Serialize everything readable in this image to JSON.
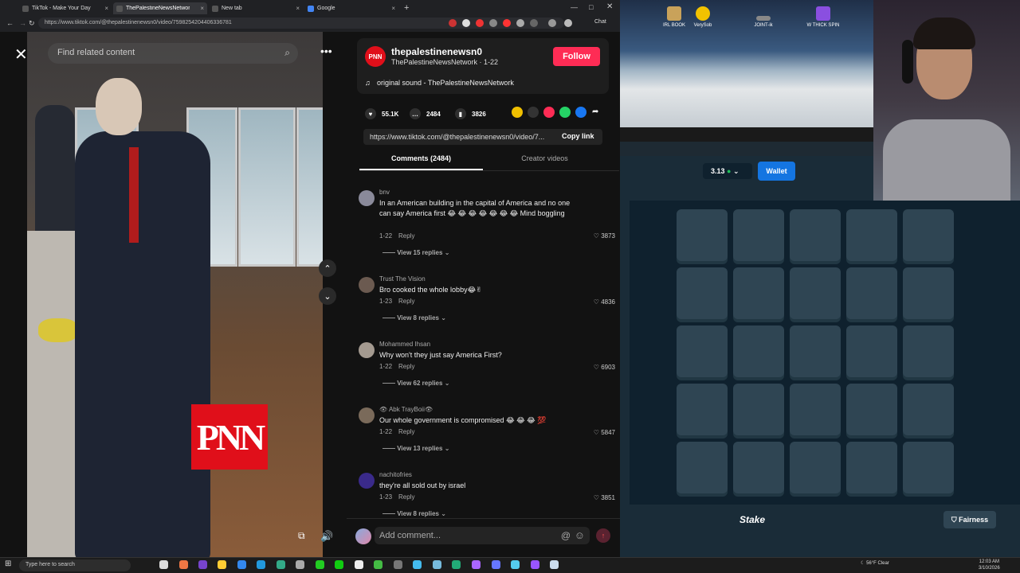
{
  "browser": {
    "tabs": [
      {
        "label": "TikTok - Make Your Day",
        "active": false
      },
      {
        "label": "ThePalestineNewsNetwork (@",
        "active": true
      },
      {
        "label": "New tab",
        "active": false
      },
      {
        "label": "Google",
        "active": false
      }
    ],
    "url": "https://www.tiktok.com/@thepalestinenewsn0/video/7598254204406336781",
    "new_tab_symbol": "+",
    "chat_label": "Chat"
  },
  "video": {
    "search_placeholder": "Find related content",
    "logo_text": "PNN"
  },
  "author": {
    "avatar_text": "PNN",
    "username": "thepalestinenewsn0",
    "display": "ThePalestineNewsNetwork · 1-22",
    "follow_label": "Follow",
    "sound": "original sound - ThePalestineNewsNetwork"
  },
  "stats": {
    "likes": "55.1K",
    "comments": "2484",
    "saves": "3826"
  },
  "link": {
    "url": "https://www.tiktok.com/@thepalestinenewsn0/video/7...",
    "copy_label": "Copy link"
  },
  "tabs": {
    "comments": "Comments (2484)",
    "creator": "Creator videos"
  },
  "comments": [
    {
      "user": "bnv",
      "text": "In an American building in the capital of America and no one can say America first 😂 😂 😂 😂 😂 😂 😂 Mind boggling",
      "date": "1-22",
      "reply": "Reply",
      "likes": "3873",
      "replies": "View 15 replies"
    },
    {
      "user": "Trust The Vision",
      "text": "Bro cooked the whole lobby😂✌",
      "date": "1-23",
      "reply": "Reply",
      "likes": "4836",
      "replies": "View 8 replies"
    },
    {
      "user": "Mohammed Ihsan",
      "text": "Why won't they just say America First?",
      "date": "1-22",
      "reply": "Reply",
      "likes": "6903",
      "replies": "View 62 replies"
    },
    {
      "user": "👁 Abk TrayBoii👁",
      "text": "Our whole government is compromised 😂 😂 😂 💯",
      "date": "1-22",
      "reply": "Reply",
      "likes": "5847",
      "replies": "View 13 replies"
    },
    {
      "user": "nachitofries",
      "text": "they're all sold out by israel",
      "date": "1-23",
      "reply": "Reply",
      "likes": "3851",
      "replies": "View 8 replies"
    }
  ],
  "composer": {
    "placeholder": "Add comment...",
    "at": "@",
    "emoji": "☺",
    "send": "↑"
  },
  "desktop_icons": [
    "IRL BOOK",
    "VerySob",
    "JOINT-ik",
    "W THICK SPIN"
  ],
  "stake": {
    "balance": "3.13",
    "wallet_label": "Wallet",
    "logo": "Stake",
    "fairness_label": "Fairness"
  },
  "taskbar": {
    "search_placeholder": "Type here to search",
    "weather": "56°F  Clear",
    "time": "12:03 AM",
    "date": "3/10/2026"
  },
  "icons": {
    "close": "✕",
    "search": "⌕",
    "more": "•••",
    "up": "⌃",
    "down": "⌄",
    "heart": "♥",
    "comment": "💬",
    "bookmark": "▮",
    "note": "♫",
    "volume": "🔊",
    "like": "♡",
    "share": "➦"
  }
}
